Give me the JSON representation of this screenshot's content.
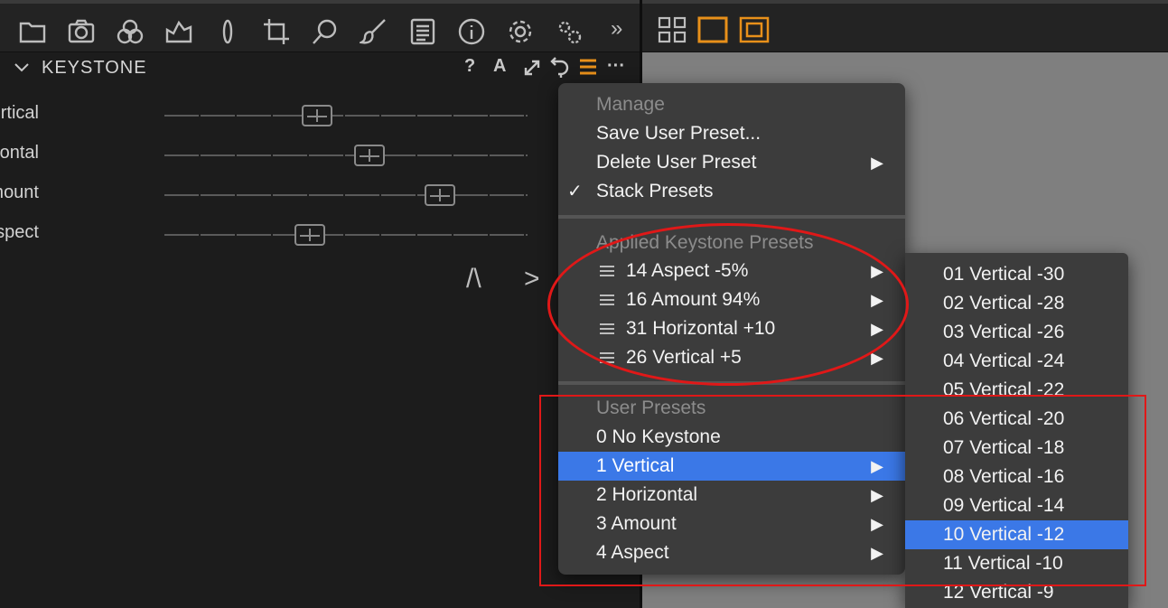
{
  "toolbar": {
    "icons": [
      "folder-icon",
      "camera-icon",
      "color-circles-icon",
      "exposure-icon",
      "lens-icon",
      "crop-icon",
      "search-icon",
      "brush-icon",
      "metadata-icon",
      "info-icon",
      "gear-icon",
      "gears-icon"
    ],
    "more": "»"
  },
  "viewer_toolbar": {
    "icons": [
      "grid-view-icon",
      "single-view-icon",
      "focus-view-icon"
    ],
    "accent": "#e8901a"
  },
  "panel": {
    "title": "KEYSTONE",
    "header_icons": {
      "help": "?",
      "auto": "A"
    },
    "sliders": [
      {
        "label": "Vertical",
        "value_fraction": 0.42
      },
      {
        "label": "Horizontal",
        "value_fraction": 0.56
      },
      {
        "label": "Amount",
        "value_fraction": 0.76
      },
      {
        "label": "Aspect",
        "value_fraction": 0.4
      }
    ],
    "glyphs": {
      "vertical": "/\\",
      "horizontal": ">"
    }
  },
  "main_menu": {
    "manage_header": "Manage",
    "save": "Save User Preset...",
    "delete": "Delete User Preset",
    "stack": "Stack Presets",
    "stack_check": "✓",
    "applied_header": "Applied Keystone Presets",
    "applied": [
      "14 Aspect -5%",
      "16 Amount 94%",
      "31 Horizontal +10",
      "26 Vertical +5"
    ],
    "user_header": "User Presets",
    "user": [
      "0 No Keystone",
      "1 Vertical",
      "2 Horizontal",
      "3 Amount",
      "4 Aspect"
    ]
  },
  "sub_menu": {
    "items": [
      "01 Vertical -30",
      "02 Vertical -28",
      "03 Vertical -26",
      "04 Vertical -24",
      "05 Vertical -22",
      "06 Vertical -20",
      "07 Vertical -18",
      "08 Vertical -16",
      "09 Vertical -14",
      "10 Vertical -12",
      "11 Vertical -10",
      "12 Vertical -9"
    ],
    "selected_index": 9
  },
  "colors": {
    "selection": "#3b78e7",
    "annotation": "#e01818",
    "accent": "#e8901a"
  }
}
